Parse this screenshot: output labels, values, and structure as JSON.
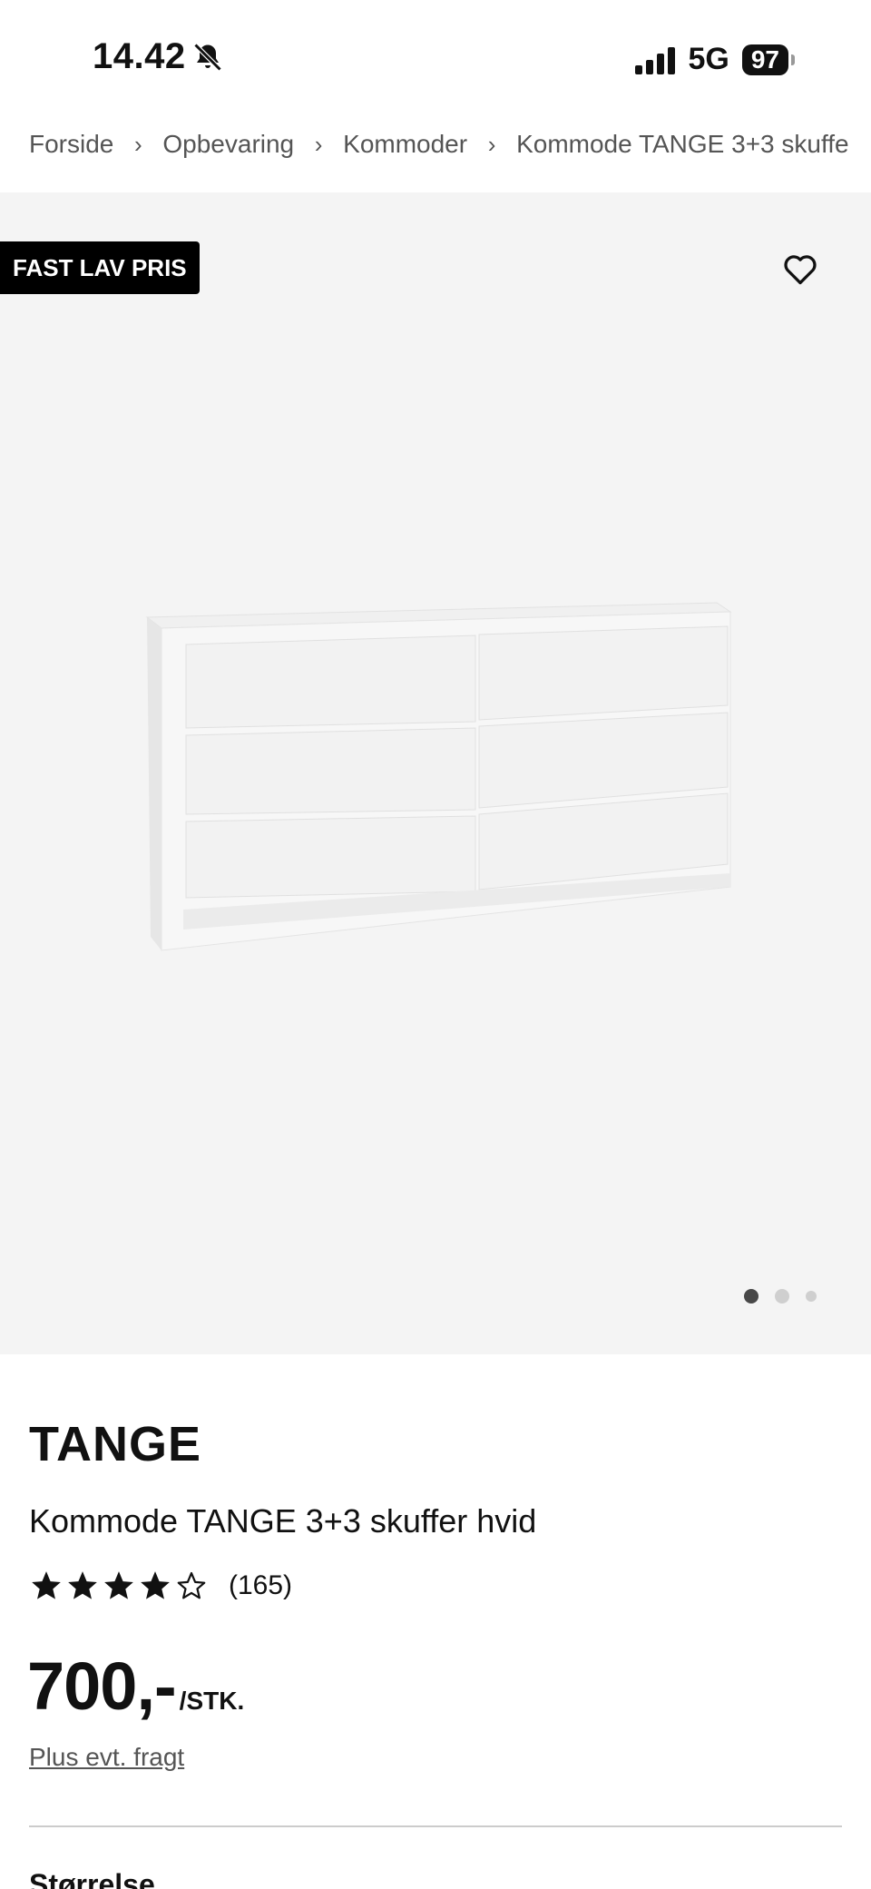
{
  "status_bar": {
    "time": "14.42",
    "network": "5G",
    "battery": "97"
  },
  "breadcrumb": [
    {
      "label": "Forside"
    },
    {
      "label": "Opbevaring"
    },
    {
      "label": "Kommoder"
    },
    {
      "label": "Kommode TANGE 3+3 skuffe"
    }
  ],
  "gallery": {
    "badge": "FAST LAV PRIS",
    "image_count": 3,
    "active_index": 0
  },
  "product": {
    "brand": "TANGE",
    "name": "Kommode TANGE 3+3 skuffer hvid",
    "rating": 4,
    "rating_max": 5,
    "review_count": "(165)",
    "price": "700,-",
    "price_unit": "/STK.",
    "shipping_note": "Plus evt. fragt",
    "next_section": "Størrelse"
  },
  "icons": {
    "bell": "bell-muted-icon",
    "signal": "signal-icon",
    "favorite": "heart-icon",
    "separator": "chevron-right-icon",
    "star": "star-icon"
  },
  "colors": {
    "badge_bg": "#000000",
    "gallery_bg": "#f4f4f4",
    "text": "#111111",
    "muted": "#555555"
  }
}
